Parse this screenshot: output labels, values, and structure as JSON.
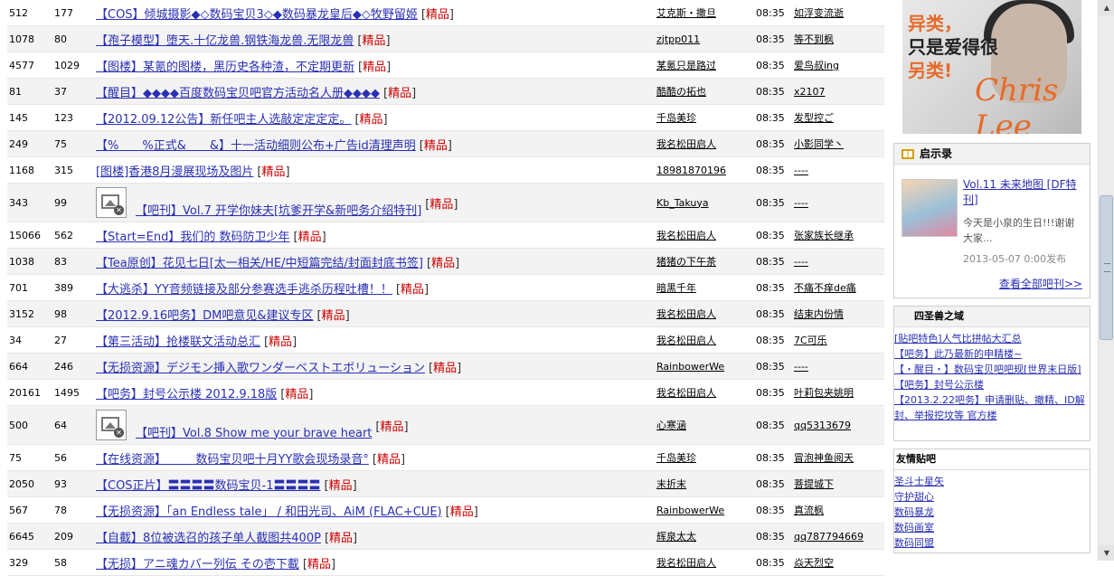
{
  "threads": [
    {
      "clicks": "512",
      "replies": "177",
      "title": "【COS】倾城摄影◆◇数码宝贝3◇◆数码暴龙皇后◆◇牧野留姬",
      "good": "精品",
      "author": "艾克斯・撒旦",
      "time": "08:35",
      "last": "如浮变流逝",
      "img": false
    },
    {
      "clicks": "1078",
      "replies": "80",
      "title": "【孢子模型】堕天.十亿龙兽.钢铁海龙兽.无限龙兽",
      "good": "精品",
      "author": "zjtpp011",
      "time": "08:35",
      "last": "等不到枫",
      "img": false
    },
    {
      "clicks": "4577",
      "replies": "1029",
      "title": "【图楼】某氪的图楼，黑历史各种渣，不定期更新",
      "good": "精品",
      "author": "某氪只是路过",
      "time": "08:35",
      "last": "爱鸟叔ing",
      "img": false
    },
    {
      "clicks": "81",
      "replies": "37",
      "title": "【醒目】◆◆◆◆百度数码宝贝吧官方活动名人册◆◆◆◆",
      "good": "精品",
      "author": "酷酷の拓也",
      "time": "08:35",
      "last": "x2107",
      "img": false
    },
    {
      "clicks": "145",
      "replies": "123",
      "title": "【2012.09.12公告】新任吧主人选敲定定定定。",
      "good": "精品",
      "author": "千岛美珍",
      "time": "08:35",
      "last": "发型控ご",
      "img": false
    },
    {
      "clicks": "249",
      "replies": "75",
      "title": "【%　　%正式&　　&】十一活动细则公布+广告id清理声明",
      "good": "精品",
      "author": "我名松田启人",
      "time": "08:35",
      "last": "小影同学丶",
      "img": false
    },
    {
      "clicks": "1168",
      "replies": "315",
      "title": "[图楼]香港8月漫展现场及图片",
      "good": "精品",
      "author": "18981870196",
      "time": "08:35",
      "last": "----",
      "img": false
    },
    {
      "clicks": "343",
      "replies": "99",
      "title": "【吧刊】Vol.7 开学你妹夫[坑爹开学&新吧务介绍特刊]",
      "good": "精品",
      "author": "Kb_Takuya",
      "time": "08:35",
      "last": "----",
      "img": true
    },
    {
      "clicks": "15066",
      "replies": "562",
      "title": "【Start=End】我们的 数码防卫少年",
      "good": "精品",
      "author": "我名松田启人",
      "time": "08:35",
      "last": "张家族长继承",
      "img": false
    },
    {
      "clicks": "1038",
      "replies": "83",
      "title": "【Tea原创】花见七日[太一相关/HE/中短篇完结/封面封底书签]",
      "good": "精品",
      "author": "猪猪の下午茶",
      "time": "08:35",
      "last": "----",
      "img": false
    },
    {
      "clicks": "701",
      "replies": "389",
      "title": "【大逃杀】YY音频链接及部分参赛选手逃杀历程吐槽！！",
      "good": "精品",
      "author": "暗黑千年",
      "time": "08:35",
      "last": "不痛不痒de痛",
      "img": false
    },
    {
      "clicks": "3152",
      "replies": "98",
      "title": "【2012.9.16吧务】DM吧意见&建议专区",
      "good": "精品",
      "author": "我名松田启人",
      "time": "08:35",
      "last": "结束内份情",
      "img": false
    },
    {
      "clicks": "34",
      "replies": "27",
      "title": "【第三活动】抢楼联文活动总汇",
      "good": "精品",
      "author": "我名松田启人",
      "time": "08:35",
      "last": "7C可乐",
      "img": false
    },
    {
      "clicks": "664",
      "replies": "246",
      "title": "【无损资源】デジモン挿入歌ワンダーベストエボリューション",
      "good": "精品",
      "author": "RainbowerWe",
      "time": "08:35",
      "last": "----",
      "img": false
    },
    {
      "clicks": "20161",
      "replies": "1495",
      "title": "【吧务】封号公示楼 2012.9.18版",
      "good": "精品",
      "author": "我名松田启人",
      "time": "08:35",
      "last": "叶莉包夹姚明",
      "img": false
    },
    {
      "clicks": "500",
      "replies": "64",
      "title": "【吧刊】Vol.8 Show me your brave heart",
      "good": "精品",
      "author": "心寒涵",
      "time": "08:35",
      "last": "qq5313679",
      "img": true
    },
    {
      "clicks": "75",
      "replies": "56",
      "title": "【在线资源】　　　数码宝贝吧十月YY歌会现场录音°",
      "good": "精品",
      "author": "千岛美珍",
      "time": "08:35",
      "last": "冒泡神鱼阅天",
      "img": false
    },
    {
      "clicks": "2050",
      "replies": "93",
      "title": "【COS正片】〓〓〓〓数码宝贝-1〓〓〓〓",
      "good": "精品",
      "author": "末折末",
      "time": "08:35",
      "last": "菩提城下",
      "img": false
    },
    {
      "clicks": "567",
      "replies": "78",
      "title": "【无损资源】「an Endless tale」 / 和田光司、AiM (FLAC+CUE)",
      "good": "精品",
      "author": "RainbowerWe",
      "time": "08:35",
      "last": "真流枫",
      "img": false
    },
    {
      "clicks": "6645",
      "replies": "209",
      "title": "【自截】8位被选召的孩子单人截图共400P",
      "good": "精品",
      "author": "辉泉太太",
      "time": "08:35",
      "last": "qq787794669",
      "img": false
    },
    {
      "clicks": "329",
      "replies": "58",
      "title": "【无损】アニ魂カバー列伝 その壱下載",
      "good": "精品",
      "author": "我名松田启人",
      "time": "08:35",
      "last": "焱天烈空",
      "img": false
    }
  ],
  "sidebar": {
    "promo": {
      "line1": "异类，",
      "line2": "只是爱得很",
      "line3": "另类!",
      "signature": "Chris Lee"
    },
    "revelation": {
      "title": "启示录",
      "mag_title": "Vol.11 未来地图 [DF特刊]",
      "mag_desc": "今天是小泉的生日!!!谢谢大家...",
      "mag_date": "2013-05-07 0:00发布",
      "more": "查看全部吧刊>>"
    },
    "beasts": {
      "title": "四圣兽之域",
      "links": [
        "[贴吧特色]人气比拼帖大汇总",
        "【吧务】此乃最新的申精楼~",
        "【・醒目・】数码宝贝吧吧规[世界末日版]",
        "【吧务】封号公示楼",
        "【2013.2.22吧务】申请删贴、撤精、ID解封、举报挖坟等 官方楼"
      ]
    },
    "friends": {
      "title": "友情贴吧",
      "links": [
        "圣斗士星矢",
        "守护甜心",
        "数码暴龙",
        "数码画室",
        "数码同盟"
      ]
    }
  },
  "colors": {
    "link": "#2a30b3",
    "good": "#cc0000",
    "orange": "#e66b2b"
  }
}
